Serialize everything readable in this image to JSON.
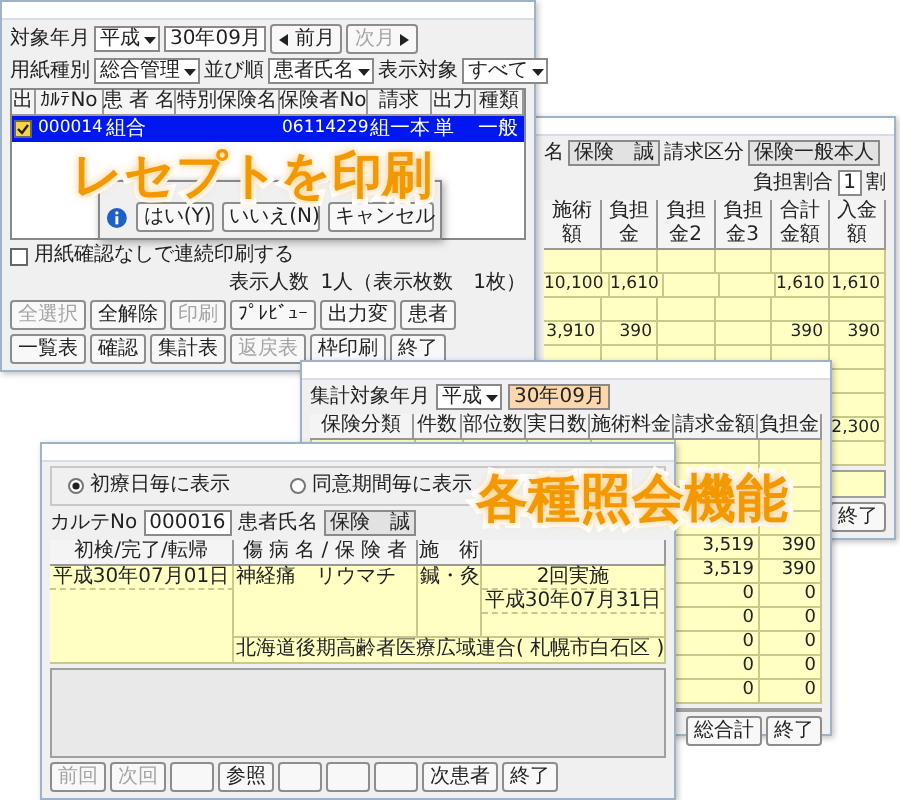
{
  "receipt_window": {
    "month_label": "対象年月",
    "era": "平成",
    "month": "30年09月",
    "prev_button": {
      "label": "前月",
      "disabled": false
    },
    "next_button": {
      "label": "次月",
      "disabled": true
    },
    "filters": [
      {
        "label": "用紙種別",
        "value": "総合管理"
      },
      {
        "label": "並び順",
        "value": "患者氏名"
      },
      {
        "label": "表示対象",
        "value": "すべて"
      }
    ],
    "table": {
      "columns": [
        "出",
        "ｶﾙﾃNo",
        "患 者 名",
        "特別保険名",
        "保険者No",
        "請求",
        "出力",
        "種類"
      ],
      "rows": [
        {
          "selected": true,
          "checked": true,
          "cells": [
            "",
            "000014",
            "組合",
            "",
            "06114229",
            "組一本",
            "単",
            "一般"
          ]
        }
      ]
    },
    "dialog": {
      "buttons": [
        "はい(Y)",
        "いいえ(N)",
        "キャンセル"
      ]
    },
    "continuous_print": {
      "label": "用紙確認なしで連続印刷する",
      "checked": false
    },
    "count_label": "表示人数",
    "count": "1人（表示枚数　1枚）",
    "buttons": [
      {
        "label": "全選択",
        "disabled": true
      },
      {
        "label": "全解除",
        "disabled": false
      },
      {
        "label": "印刷",
        "disabled": true
      },
      {
        "label": "ﾌﾟﾚﾋﾞｭｰ",
        "disabled": false
      },
      {
        "label": "出力変",
        "disabled": false
      },
      {
        "label": "患者",
        "disabled": false
      },
      {
        "label": "一覧表",
        "disabled": false
      },
      {
        "label": "確認",
        "disabled": false
      },
      {
        "label": "集計表",
        "disabled": false
      },
      {
        "label": "返戻表",
        "disabled": true
      },
      {
        "label": "枠印刷",
        "disabled": false
      },
      {
        "label": "終了",
        "disabled": false
      }
    ]
  },
  "detail_window": {
    "patient_label": "名",
    "patient": "保険　誠",
    "claim_label": "請求区分",
    "claim": "保険一般本人",
    "ratio_label": "負担割合",
    "ratio": "1",
    "ratio_unit": "割",
    "columns": [
      "施術額",
      "負担金",
      "負担金2",
      "負担金3",
      "合計金額",
      "入金額"
    ],
    "rows": [
      [
        "",
        "",
        "",
        "",
        "",
        ""
      ],
      [
        "10,100",
        "1,610",
        "",
        "",
        "1,610",
        "1,610"
      ],
      [
        "",
        "",
        "",
        "",
        "",
        ""
      ],
      [
        "3,910",
        "390",
        "",
        "",
        "390",
        "390"
      ],
      [
        "",
        "",
        "",
        "",
        "",
        ""
      ],
      [
        "",
        "",
        "",
        "",
        "",
        ""
      ],
      [
        "",
        "",
        "",
        "",
        "",
        ""
      ],
      [
        "",
        "",
        "",
        "",
        "",
        "2,300"
      ],
      [
        "",
        "",
        "",
        "",
        "",
        ""
      ]
    ],
    "buttons": [
      "終了"
    ]
  },
  "summary_window": {
    "month_label": "集計対象年月",
    "era": "平成",
    "month": "30年09月",
    "columns": [
      "保険分類",
      "件数",
      "部位数",
      "実日数",
      "施術料金",
      "請求金額",
      "負担金"
    ],
    "rows": [
      [
        "",
        "",
        "",
        "",
        "",
        "",
        ""
      ],
      [
        "",
        "",
        "",
        "",
        "",
        "",
        ""
      ],
      [
        "",
        "",
        "",
        "",
        "",
        "",
        ""
      ],
      [
        "",
        "",
        "",
        "",
        "",
        "",
        ""
      ],
      [
        "",
        "",
        "",
        "",
        "",
        "3,519",
        "390"
      ],
      [
        "",
        "",
        "",
        "",
        "",
        "3,519",
        "390"
      ],
      [
        "",
        "",
        "",
        "",
        "",
        "0",
        "0"
      ],
      [
        "",
        "",
        "",
        "",
        "",
        "0",
        "0"
      ],
      [
        "",
        "",
        "",
        "",
        "",
        "0",
        "0"
      ],
      [
        "",
        "",
        "",
        "",
        "",
        "0",
        "0"
      ],
      [
        "",
        "",
        "",
        "",
        "",
        "0",
        "0"
      ]
    ],
    "buttons": [
      {
        "kind": "label",
        "label": "総合計"
      },
      {
        "kind": "label",
        "label": "終了"
      }
    ]
  },
  "patient_window": {
    "display_options": [
      {
        "label": "初療日毎に表示",
        "selected": true
      },
      {
        "label": "同意期間毎に表示",
        "selected": false
      }
    ],
    "chart_label": "カルテNo",
    "chart_no": "000016",
    "name_label": "患者氏名",
    "name": "保険　誠",
    "columns": [
      "初検/完了/転帰",
      "傷 病 名 / 保 険 者",
      "施　術"
    ],
    "episodes": [
      {
        "start": "平成30年07月01日",
        "disease": "神経痛　リウマチ",
        "treatment": "鍼・灸",
        "status": "2回実施",
        "end": "平成30年07月31日",
        "insurer": "北海道後期高齢者医療広域連合( 札幌市白石区 )"
      }
    ],
    "buttons": [
      {
        "kind": "label",
        "label": "前回",
        "disabled": true
      },
      {
        "kind": "label",
        "label": "次回",
        "disabled": true
      },
      {
        "kind": "blank"
      },
      {
        "kind": "label",
        "label": "参照",
        "disabled": false
      },
      {
        "kind": "blank"
      },
      {
        "kind": "blank"
      },
      {
        "kind": "blank"
      },
      {
        "kind": "label",
        "label": "次患者",
        "disabled": false
      },
      {
        "kind": "label",
        "label": "終了",
        "disabled": false
      }
    ]
  },
  "captions": [
    {
      "text": "レセプトを印刷"
    },
    {
      "text": "各種照会機能"
    }
  ]
}
